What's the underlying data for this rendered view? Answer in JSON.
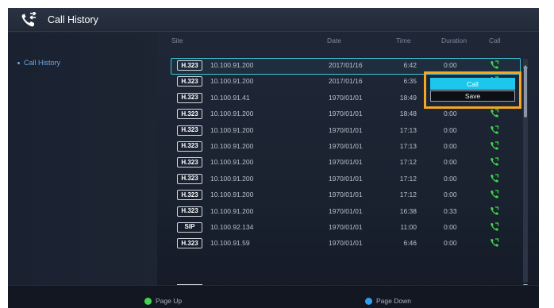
{
  "app": {
    "title": "Call History",
    "title_icon": "phone-history-icon"
  },
  "sidebar": {
    "items": [
      {
        "label": "Call History",
        "active": true
      }
    ]
  },
  "table": {
    "headers": {
      "site": "Site",
      "date": "Date",
      "time": "Time",
      "duration": "Duration",
      "call": "Call"
    },
    "rows": [
      {
        "protocol": "H.323",
        "site": "10.100.91.200",
        "date": "2017/01/16",
        "time": "6:42",
        "duration": "0:00",
        "selected": true
      },
      {
        "protocol": "H.323",
        "site": "10.100.91.200",
        "date": "2017/01/16",
        "time": "6:35",
        "duration": ""
      },
      {
        "protocol": "H.323",
        "site": "10.100.91.41",
        "date": "1970/01/01",
        "time": "18:49",
        "duration": ""
      },
      {
        "protocol": "H.323",
        "site": "10.100.91.200",
        "date": "1970/01/01",
        "time": "18:48",
        "duration": "0:00"
      },
      {
        "protocol": "H.323",
        "site": "10.100.91.200",
        "date": "1970/01/01",
        "time": "17:13",
        "duration": "0:00"
      },
      {
        "protocol": "H.323",
        "site": "10.100.91.200",
        "date": "1970/01/01",
        "time": "17:13",
        "duration": "0:00"
      },
      {
        "protocol": "H.323",
        "site": "10.100.91.200",
        "date": "1970/01/01",
        "time": "17:12",
        "duration": "0:00"
      },
      {
        "protocol": "H.323",
        "site": "10.100.91.200",
        "date": "1970/01/01",
        "time": "17:12",
        "duration": "0:00"
      },
      {
        "protocol": "H.323",
        "site": "10.100.91.200",
        "date": "1970/01/01",
        "time": "17:12",
        "duration": "0:00"
      },
      {
        "protocol": "H.323",
        "site": "10.100.91.200",
        "date": "1970/01/01",
        "time": "16:38",
        "duration": "0:33"
      },
      {
        "protocol": "SIP",
        "site": "10.100.92.134",
        "date": "1970/01/01",
        "time": "11:00",
        "duration": "0:00"
      },
      {
        "protocol": "H.323",
        "site": "10.100.91.59",
        "date": "1970/01/01",
        "time": "6:46",
        "duration": "0:00"
      }
    ]
  },
  "context_menu": {
    "items": [
      {
        "label": "Call",
        "highlighted": true
      },
      {
        "label": "Save"
      }
    ]
  },
  "footer": {
    "page_up": {
      "label": "Page Up",
      "color": "#3fd84d"
    },
    "page_down": {
      "label": "Page Down",
      "color": "#2f9df0"
    }
  },
  "colors": {
    "accent": "#1cc6ec",
    "highlight_border": "#f5a623",
    "call_icon": "#3fd84d",
    "selection": "#3ec6db"
  }
}
